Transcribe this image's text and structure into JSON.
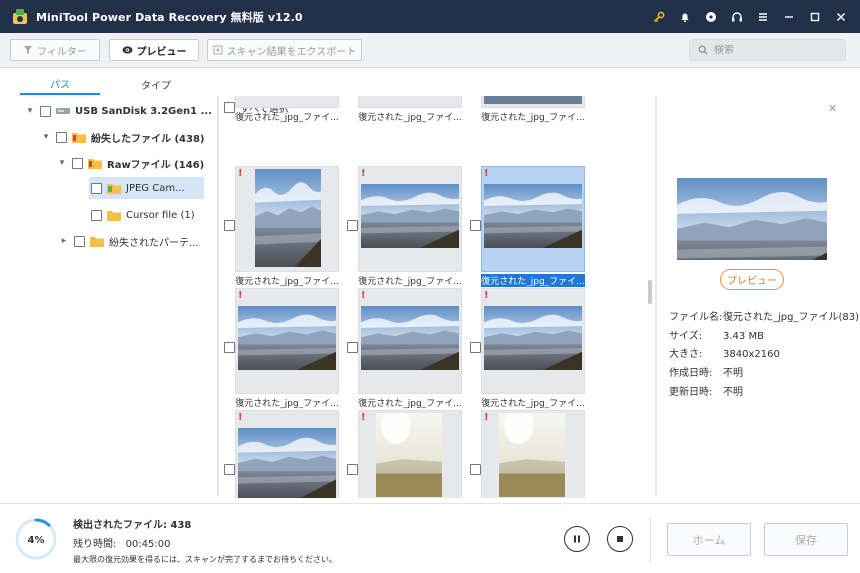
{
  "app": {
    "title": "MiniTool Power Data Recovery 無料版 v12.0"
  },
  "titlebar_icons": [
    "key-icon",
    "bell-icon",
    "disc-icon",
    "headset-icon",
    "menu-icon",
    "minimize-icon",
    "maximize-icon",
    "close-icon"
  ],
  "toolbar": {
    "filter_label": "フィルター",
    "preview_label": "プレビュー",
    "export_label": "スキャン結果をエクスポート",
    "search_placeholder": "検索"
  },
  "tabs": [
    {
      "label": "パス"
    },
    {
      "label": "タイプ"
    }
  ],
  "tree": [
    {
      "label": "USB SanDisk 3.2Gen1 ...",
      "icon": "usb-drive-icon",
      "expanded": true
    },
    {
      "label": "紛失したファイル (438)",
      "icon": "lost-folder-icon",
      "expanded": true
    },
    {
      "label": "Rawファイル (146)",
      "icon": "raw-folder-icon",
      "expanded": true
    },
    {
      "label": "JPEG Cam...",
      "icon": "jpeg-folder-icon",
      "selected": true
    },
    {
      "label": "Cursor file (1)",
      "icon": "folder-icon"
    },
    {
      "label": "紛失されたパーテ...",
      "icon": "folder-icon",
      "expanded": false
    }
  ],
  "middle": {
    "select_all_label": "すべて選択",
    "file_name": "復元された_jpg_ファイ..."
  },
  "preview": {
    "preview_button": "プレビュー",
    "info": [
      {
        "key": "ファイル名:",
        "value": "復元された_jpg_ファイル(83)"
      },
      {
        "key": "サイズ:",
        "value": "3.43 MB"
      },
      {
        "key": "大きさ:",
        "value": "3840x2160"
      },
      {
        "key": "作成日時:",
        "value": "不明"
      },
      {
        "key": "更新日時:",
        "value": "不明"
      }
    ]
  },
  "status": {
    "progress_label": "4%",
    "progress_percent": 4,
    "found_label": "検出されたファイル:",
    "found_count": "438",
    "remaining_label": "残り時間:",
    "remaining_time": "00:45:00",
    "note": "最大限の復元効果を得るには、スキャンが完了するまでお待ちください。",
    "home_label": "ホーム",
    "save_label": "保存"
  },
  "colors": {
    "titlebar": "#23304a",
    "accent": "#1e88e5",
    "orange": "#f08d44",
    "warning": "#e53935"
  }
}
